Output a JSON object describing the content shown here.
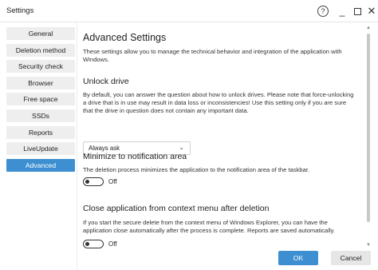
{
  "window": {
    "title": "Settings",
    "help_glyph": "?",
    "minimize_glyph": "_",
    "close_glyph": "✕"
  },
  "sidebar": {
    "items": [
      {
        "label": "General",
        "active": false
      },
      {
        "label": "Deletion method",
        "active": false
      },
      {
        "label": "Security check",
        "active": false
      },
      {
        "label": "Browser",
        "active": false
      },
      {
        "label": "Free space",
        "active": false
      },
      {
        "label": "SSDs",
        "active": false
      },
      {
        "label": "Reports",
        "active": false
      },
      {
        "label": "LiveUpdate",
        "active": false
      },
      {
        "label": "Advanced",
        "active": true
      }
    ]
  },
  "main": {
    "title": "Advanced Settings",
    "intro": "These settings allow you to manage the technical behavior and integration of the application with Windows.",
    "unlock": {
      "heading": "Unlock drive",
      "description": "By default, you can answer the question about how to unlock drives. Please note that force-unlocking a drive that is in use may result in data loss or inconsistencies! Use this setting only if you are sure that the drive in question does not contain any important data.",
      "select_value": "Always ask"
    },
    "minimize": {
      "heading": "Minimize to notification area",
      "description": "The deletion process minimizes the application to the notification area of the taskbar.",
      "toggle_state": "Off",
      "enabled": false
    },
    "close_app": {
      "heading": "Close application from context menu after deletion",
      "description": "If you start the secure delete from the context menu of Windows Explorer, you can have the application close automatically after the process is complete. Reports are saved automatically.",
      "toggle_state": "Off",
      "enabled": false
    }
  },
  "footer": {
    "ok_label": "OK",
    "cancel_label": "Cancel"
  },
  "colors": {
    "accent": "#3d8fd1",
    "nav_bg": "#eeeeee",
    "cancel_bg": "#e6e6e6"
  }
}
